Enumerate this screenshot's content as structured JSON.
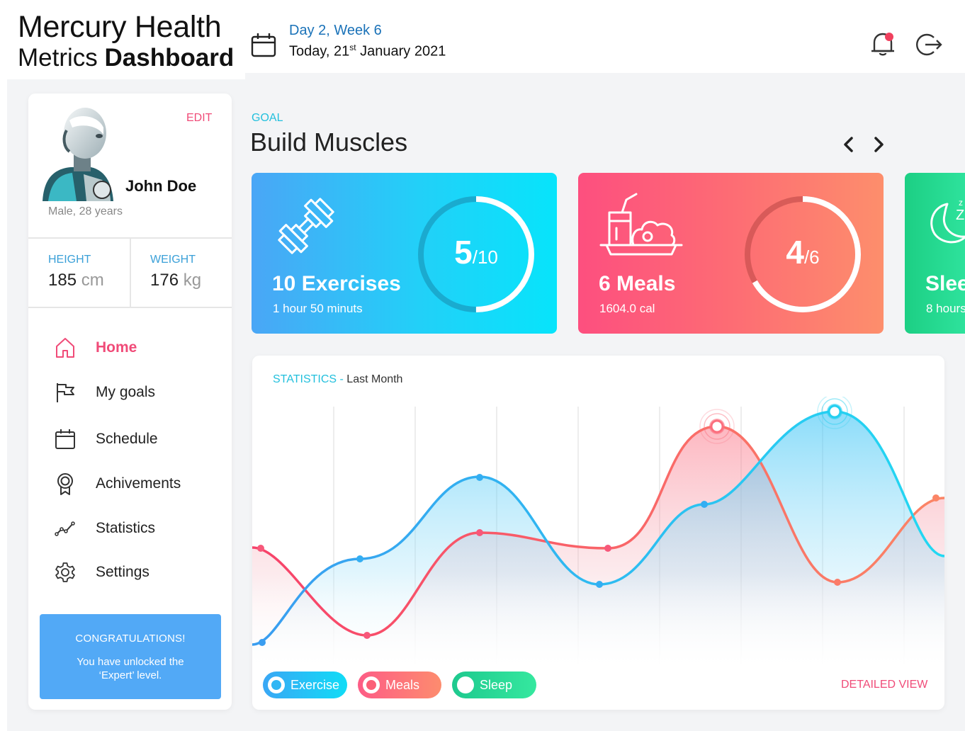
{
  "app": {
    "title_line1": "Mercury Health",
    "title_line2_regular": "Metrics ",
    "title_line2_bold": "Dashboard"
  },
  "header": {
    "day_week": "Day 2, Week 6",
    "today_prefix": "Today, 21",
    "today_sup": "st",
    "today_suffix": " January 2021",
    "notification_badge_color": "#f0405e"
  },
  "profile": {
    "edit_label": "EDIT",
    "name": "John Doe",
    "meta": "Male, 28 years",
    "height_label": "HEIGHT",
    "height_value": "185",
    "height_unit": " cm",
    "weight_label": "WEIGHT",
    "weight_value": "176",
    "weight_unit": " kg"
  },
  "nav": [
    {
      "label": "Home",
      "icon": "home-icon",
      "active": true
    },
    {
      "label": "My goals",
      "icon": "flag-icon",
      "active": false
    },
    {
      "label": "Schedule",
      "icon": "calendar-icon",
      "active": false
    },
    {
      "label": "Achivements",
      "icon": "award-icon",
      "active": false
    },
    {
      "label": "Statistics",
      "icon": "trend-icon",
      "active": false
    },
    {
      "label": "Settings",
      "icon": "gear-icon",
      "active": false
    }
  ],
  "congrats": {
    "title": "CONGRATULATIONS!",
    "text": "You have unlocked the ‘Expert’ level."
  },
  "goal": {
    "label": "GOAL",
    "title": "Build Muscles"
  },
  "cards": {
    "exercise": {
      "title": "10 Exercises",
      "sub": "1 hour 50 minuts",
      "progress_done": "5",
      "progress_total": "/10",
      "fraction": 0.5,
      "icon": "dumbbell-icon"
    },
    "meals": {
      "title": "6 Meals",
      "sub": "1604.0 cal",
      "progress_done": "4",
      "progress_total": "/6",
      "fraction": 0.667,
      "icon": "meal-icon"
    },
    "sleep": {
      "title": "Slee",
      "sub": "8 hours",
      "icon": "moon-icon"
    }
  },
  "stats": {
    "label_pre": "STATISTICS - ",
    "label_post": "Last Month",
    "detailed_view": "DETAILED VIEW"
  },
  "legend": {
    "exercise": "Exercise",
    "meals": "Meals",
    "sleep": "Sleep"
  },
  "colors": {
    "exercise": "#2fb6f4",
    "meals": "#fb5f77",
    "sleep": "#2ad98f",
    "accent_pink": "#f04b78",
    "accent_cyan": "#23c0dd"
  }
}
